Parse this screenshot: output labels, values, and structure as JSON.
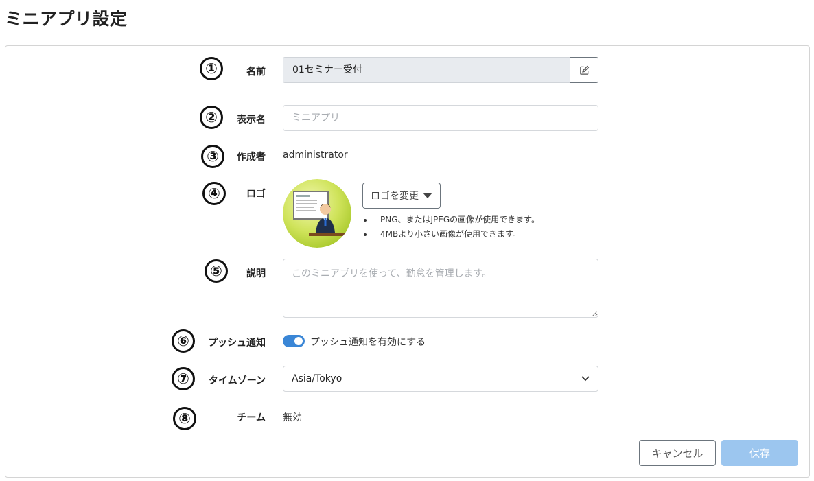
{
  "page": {
    "title": "ミニアプリ設定"
  },
  "markers": [
    "①",
    "②",
    "③",
    "④",
    "⑤",
    "⑥",
    "⑦",
    "⑧"
  ],
  "fields": {
    "name": {
      "label": "名前",
      "value": "01セミナー受付"
    },
    "display_name": {
      "label": "表示名",
      "placeholder": "ミニアプリ"
    },
    "creator": {
      "label": "作成者",
      "value": "administrator"
    },
    "logo": {
      "label": "ロゴ",
      "change_button": "ロゴを変更",
      "notes": [
        "PNG、またはJPEGの画像が使用できます。",
        "4MBより小さい画像が使用できます。"
      ]
    },
    "description": {
      "label": "説明",
      "placeholder": "このミニアプリを使って、勤怠を管理します。"
    },
    "push": {
      "label": "プッシュ通知",
      "toggle_label": "プッシュ通知を有効にする",
      "enabled": true
    },
    "timezone": {
      "label": "タイムゾーン",
      "value": "Asia/Tokyo"
    },
    "team": {
      "label": "チーム",
      "value": "無効"
    }
  },
  "actions": {
    "cancel": "キャンセル",
    "save": "保存"
  },
  "colors": {
    "accent": "#3a86d6",
    "save_button": "#9cc6ef",
    "readonly_bg": "#e8ebef"
  },
  "icons": [
    "edit-icon",
    "caret-down-icon",
    "chevron-down-icon"
  ]
}
